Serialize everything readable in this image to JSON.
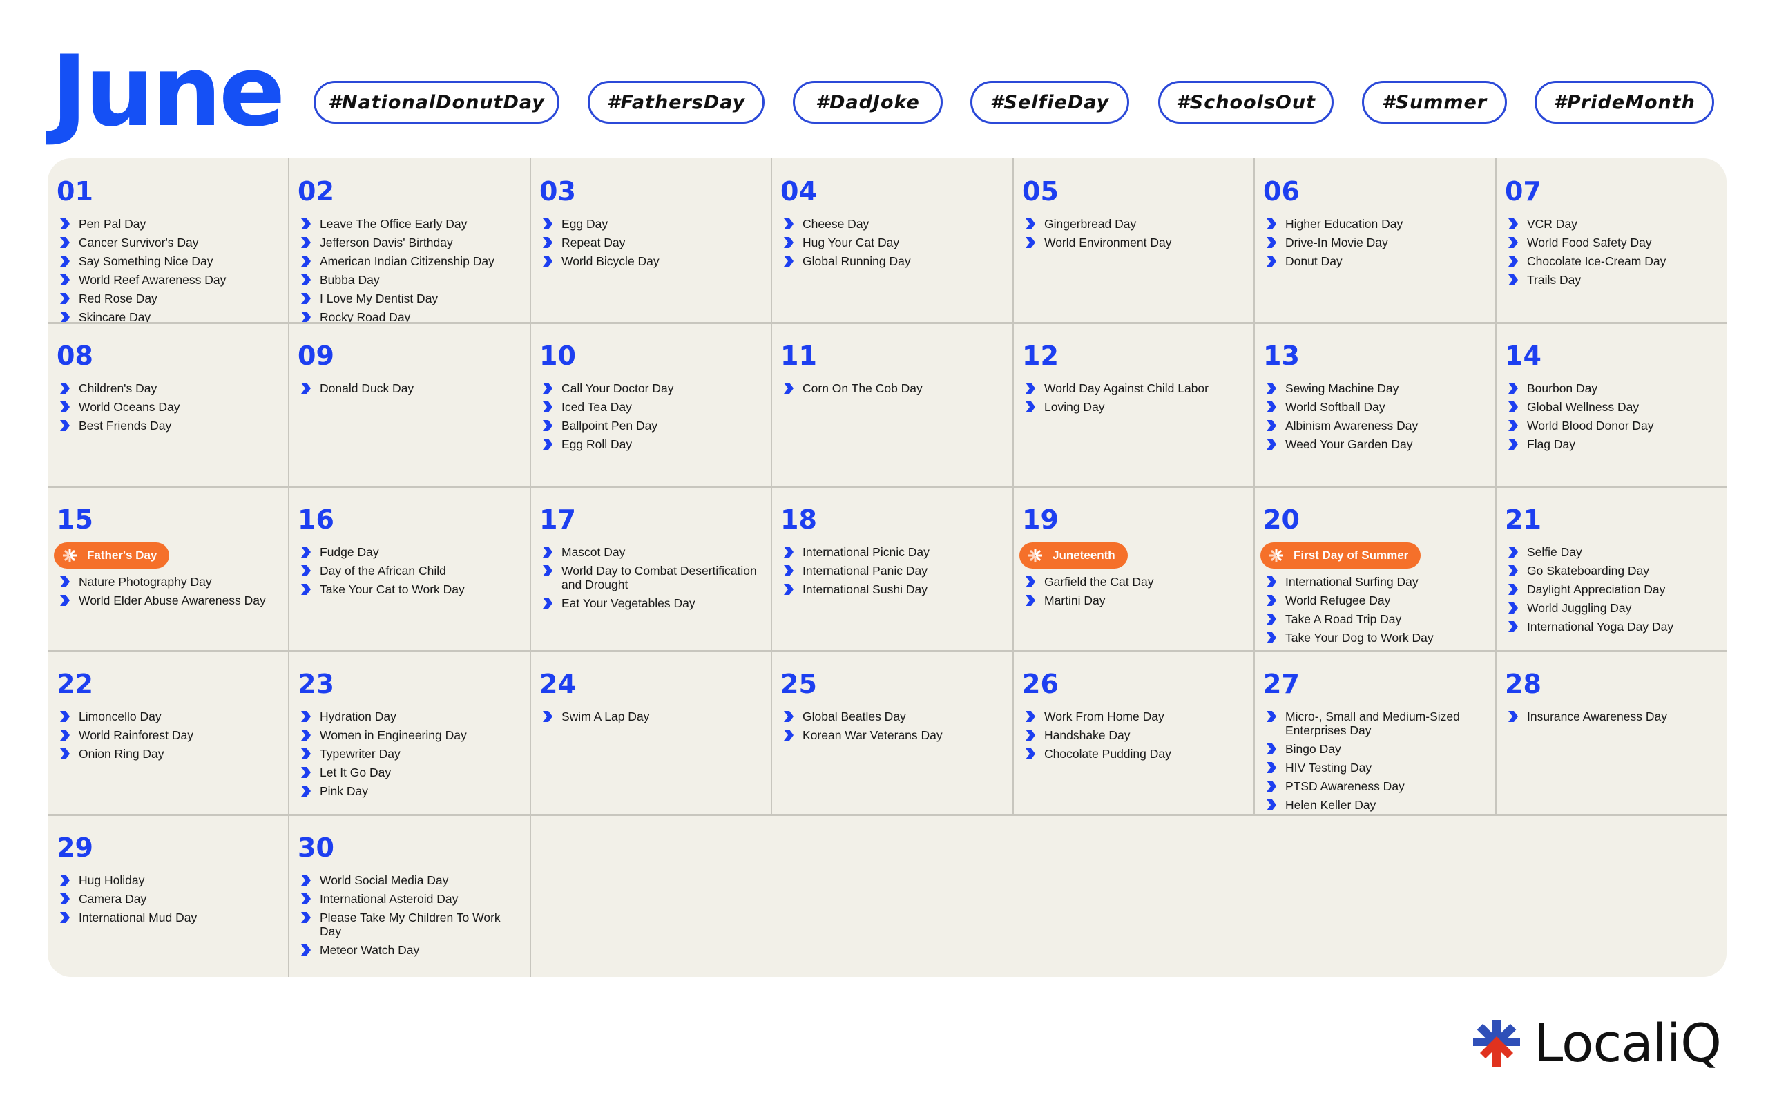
{
  "title": "June",
  "hashtags": [
    "#NationalDonutDay",
    "#FathersDay",
    "#DadJoke",
    "#SelfieDay",
    "#SchoolsOut",
    "#Summer",
    "#PrideMonth"
  ],
  "colors": {
    "accent_blue": "#1d3ff0",
    "badge_orange": "#f5702a",
    "grid_bg": "#f2f0e8",
    "logo_blue": "#2f4fb8",
    "logo_red": "#e0321e"
  },
  "days": [
    {
      "num": "01",
      "events": [
        "Pen Pal Day",
        "Cancer Survivor's Day",
        "Say Something Nice Day",
        "World Reef Awareness Day",
        "Red Rose Day",
        "Skincare Day"
      ]
    },
    {
      "num": "02",
      "events": [
        "Leave The Office Early Day",
        "Jefferson Davis' Birthday",
        "American Indian Citizenship Day",
        "Bubba Day",
        "I Love My Dentist Day",
        "Rocky Road Day"
      ]
    },
    {
      "num": "03",
      "events": [
        "Egg Day",
        "Repeat Day",
        "World Bicycle Day"
      ]
    },
    {
      "num": "04",
      "events": [
        "Cheese Day",
        "Hug Your Cat Day",
        "Global Running Day"
      ]
    },
    {
      "num": "05",
      "events": [
        "Gingerbread Day",
        "World Environment Day"
      ]
    },
    {
      "num": "06",
      "events": [
        "Higher Education Day",
        "Drive-In Movie Day",
        "Donut Day"
      ]
    },
    {
      "num": "07",
      "events": [
        "VCR Day",
        "World Food Safety Day",
        "Chocolate Ice-Cream Day",
        "Trails Day"
      ]
    },
    {
      "num": "08",
      "events": [
        "Children's Day",
        "World Oceans Day",
        "Best Friends Day"
      ]
    },
    {
      "num": "09",
      "events": [
        "Donald Duck Day"
      ]
    },
    {
      "num": "10",
      "events": [
        "Call Your Doctor Day",
        "Iced Tea Day",
        "Ballpoint Pen Day",
        "Egg Roll Day"
      ]
    },
    {
      "num": "11",
      "events": [
        "Corn On The Cob Day"
      ]
    },
    {
      "num": "12",
      "events": [
        "World Day Against Child Labor",
        "Loving Day"
      ]
    },
    {
      "num": "13",
      "events": [
        "Sewing Machine Day",
        "World Softball Day",
        "Albinism Awareness Day",
        "Weed Your Garden Day"
      ]
    },
    {
      "num": "14",
      "events": [
        "Bourbon Day",
        "Global Wellness Day",
        "World Blood Donor Day",
        "Flag Day"
      ]
    },
    {
      "num": "15",
      "badge": "Father's Day",
      "events": [
        "Nature Photography Day",
        "World Elder Abuse Awareness Day"
      ]
    },
    {
      "num": "16",
      "events": [
        "Fudge Day",
        "Day of the African Child",
        "Take Your Cat to Work Day"
      ]
    },
    {
      "num": "17",
      "events": [
        "Mascot Day",
        "World Day to Combat Desertification and Drought",
        "Eat Your Vegetables Day"
      ]
    },
    {
      "num": "18",
      "events": [
        "International Picnic Day",
        "International Panic Day",
        "International Sushi Day"
      ]
    },
    {
      "num": "19",
      "badge": "Juneteenth",
      "events": [
        "Garfield the Cat Day",
        "Martini Day"
      ]
    },
    {
      "num": "20",
      "badge": "First Day of Summer",
      "events": [
        "International Surfing Day",
        "World Refugee Day",
        "Take A Road Trip Day",
        "Take Your Dog to Work Day"
      ]
    },
    {
      "num": "21",
      "events": [
        "Selfie Day",
        "Go Skateboarding Day",
        "Daylight Appreciation Day",
        "World Juggling Day",
        "International Yoga Day Day"
      ]
    },
    {
      "num": "22",
      "events": [
        "Limoncello Day",
        "World Rainforest Day",
        "Onion Ring Day"
      ]
    },
    {
      "num": "23",
      "events": [
        "Hydration Day",
        "Women in Engineering Day",
        "Typewriter Day",
        "Let It Go Day",
        "Pink Day"
      ]
    },
    {
      "num": "24",
      "events": [
        "Swim A Lap Day"
      ]
    },
    {
      "num": "25",
      "events": [
        "Global Beatles Day",
        "Korean War Veterans Day"
      ]
    },
    {
      "num": "26",
      "events": [
        "Work From Home Day",
        "Handshake Day",
        "Chocolate Pudding Day"
      ]
    },
    {
      "num": "27",
      "events": [
        "Micro-, Small and Medium-Sized Enterprises Day",
        "Bingo Day",
        "HIV Testing Day",
        "PTSD Awareness Day",
        "Helen Keller Day"
      ]
    },
    {
      "num": "28",
      "events": [
        "Insurance Awareness Day"
      ]
    },
    {
      "num": "29",
      "events": [
        "Hug Holiday",
        "Camera Day",
        "International Mud Day"
      ]
    },
    {
      "num": "30",
      "events": [
        "World Social Media Day",
        "International Asteroid Day",
        "Please Take My Children To Work Day",
        "Meteor Watch Day"
      ]
    }
  ],
  "logo": {
    "text": "LocaliQ",
    "icon": "asterisk-logo-icon"
  }
}
